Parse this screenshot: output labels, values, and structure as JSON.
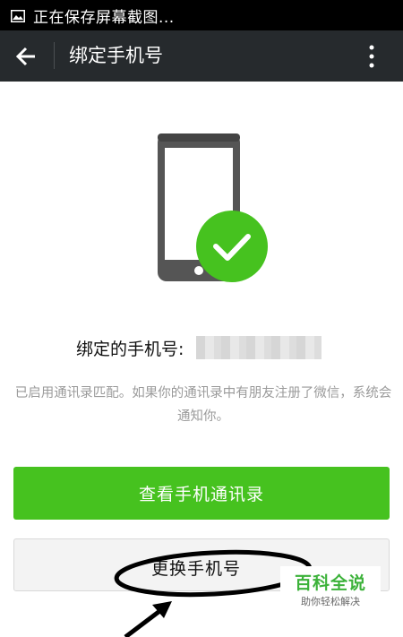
{
  "status_bar": {
    "text": "正在保存屏幕截图...",
    "icon": "image-icon"
  },
  "app_bar": {
    "back_icon": "arrow-left-icon",
    "title": "绑定手机号",
    "more_icon": "more-vertical-icon"
  },
  "illustration": {
    "icon": "phone-check-icon",
    "colors": {
      "phone": "#555555",
      "check_circle": "#46c21f"
    }
  },
  "bound": {
    "label": "绑定的手机号:",
    "number_masked": true
  },
  "description": "已启用通讯录匹配。如果你的通讯录中有朋友注册了微信，系统会通知你。",
  "buttons": {
    "view_contacts": "查看手机通讯录",
    "change_number": "更换手机号"
  },
  "watermark": {
    "main": "百科全说",
    "sub": "助你轻松解决"
  },
  "colors": {
    "accent": "#46c21f",
    "app_bar": "#262a2d",
    "status_bar": "#000000"
  }
}
